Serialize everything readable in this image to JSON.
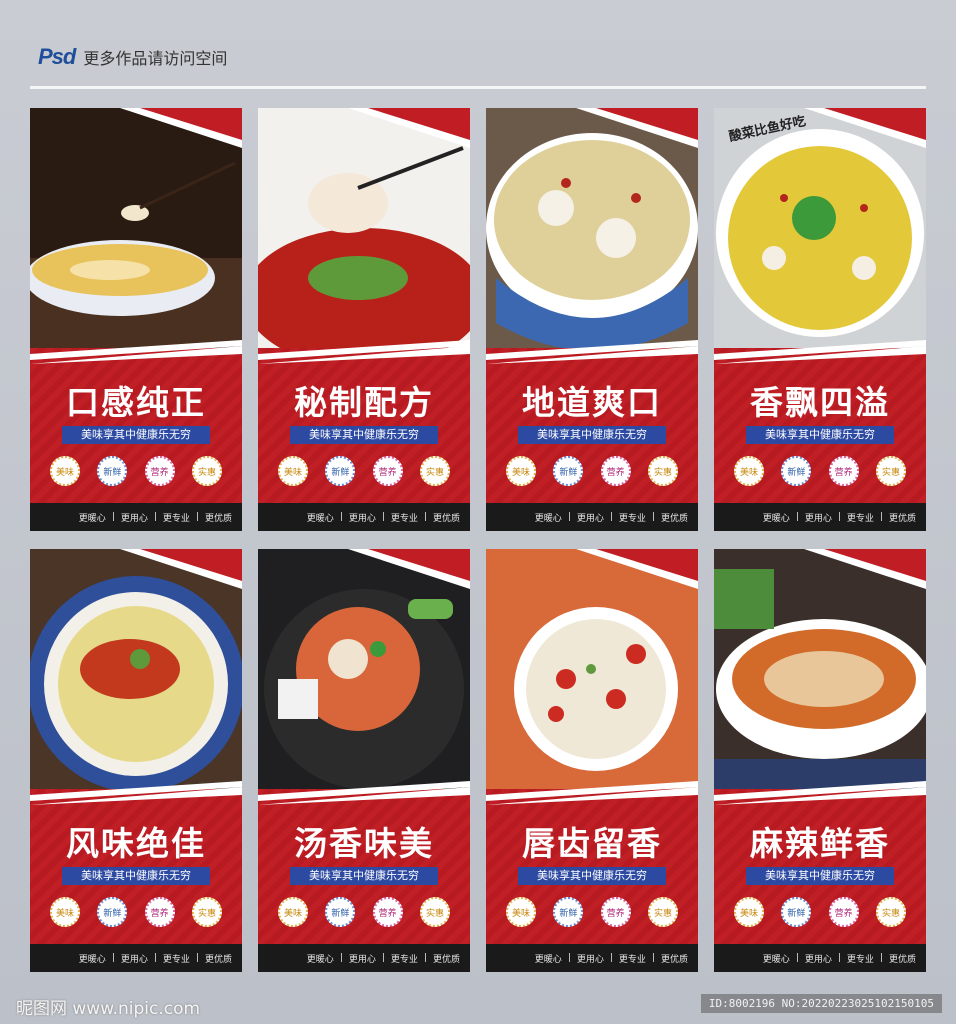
{
  "header": {
    "logo_text": "Psd",
    "caption": "更多作品请访问空间"
  },
  "posters": [
    {
      "title": "口感纯正",
      "subtitle": "美味享其中健康乐无穷"
    },
    {
      "title": "秘制配方",
      "subtitle": "美味享其中健康乐无穷"
    },
    {
      "title": "地道爽口",
      "subtitle": "美味享其中健康乐无穷"
    },
    {
      "title": "香飘四溢",
      "subtitle": "美味享其中健康乐无穷"
    },
    {
      "title": "风味绝佳",
      "subtitle": "美味享其中健康乐无穷"
    },
    {
      "title": "汤香味美",
      "subtitle": "美味享其中健康乐无穷"
    },
    {
      "title": "唇齿留香",
      "subtitle": "美味享其中健康乐无穷"
    },
    {
      "title": "麻辣鲜香",
      "subtitle": "美味享其中健康乐无穷"
    }
  ],
  "badges": [
    "美味",
    "新鲜",
    "营养",
    "实惠"
  ],
  "footer_items": [
    "更暖心",
    "更用心",
    "更专业",
    "更优质"
  ],
  "bowl_lettering": "酸菜比鱼好吃",
  "watermark": {
    "site": "昵图网 www.nipic.com",
    "id": "ID:8002196 NO:20220223025102150105"
  },
  "colors": {
    "poster_red": "#c01e24",
    "subtitle_blue": "#2d4aa3",
    "footer_black": "#1a1a1a"
  }
}
